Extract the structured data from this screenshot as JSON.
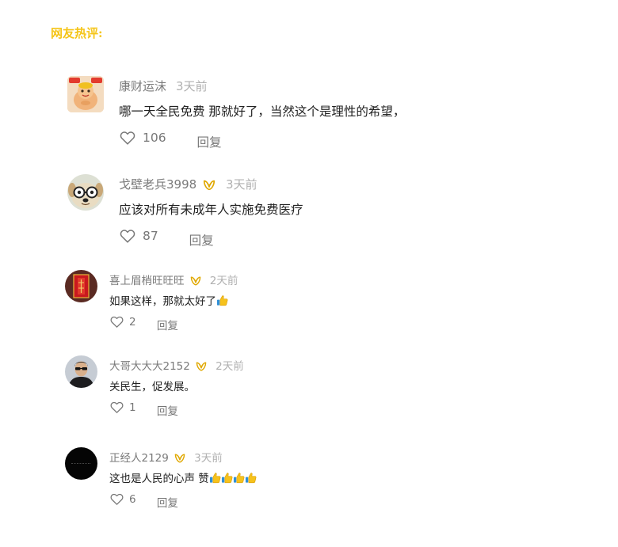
{
  "section": {
    "title": "网友热评:"
  },
  "comments": [
    {
      "user": "康财运沫",
      "time": "3天前",
      "badge": false,
      "text": "哪一天全民免费 那就好了，当然这个是理性的希望，",
      "likes": "106",
      "reply_label": "回复",
      "avatar_icon": "cartoon-mascot-avatar"
    },
    {
      "user": "戈壁老兵3998",
      "time": "3天前",
      "badge": true,
      "text": "应该对所有未成年人实施免费医疗",
      "likes": "87",
      "reply_label": "回复",
      "avatar_icon": "cartoon-dog-glasses-avatar"
    },
    {
      "user": "喜上眉梢旺旺旺",
      "time": "2天前",
      "badge": true,
      "text": "如果这样，那就太好了",
      "likes": "2",
      "reply_label": "回复",
      "avatar_icon": "red-scroll-avatar"
    },
    {
      "user": "大哥大大大2152",
      "time": "2天前",
      "badge": true,
      "text": "关民生，促发展。",
      "likes": "1",
      "reply_label": "回复",
      "avatar_icon": "man-sunglasses-avatar"
    },
    {
      "user": "正经人2129",
      "time": "3天前",
      "badge": true,
      "text": "这也是人民的心声 赞",
      "likes": "6",
      "reply_label": "回复",
      "avatar_icon": "black-circle-avatar"
    }
  ],
  "colors": {
    "title": "#f5c518",
    "username": "#7a7a7a",
    "time": "#b0b0b0",
    "badge": "#e0a800"
  }
}
